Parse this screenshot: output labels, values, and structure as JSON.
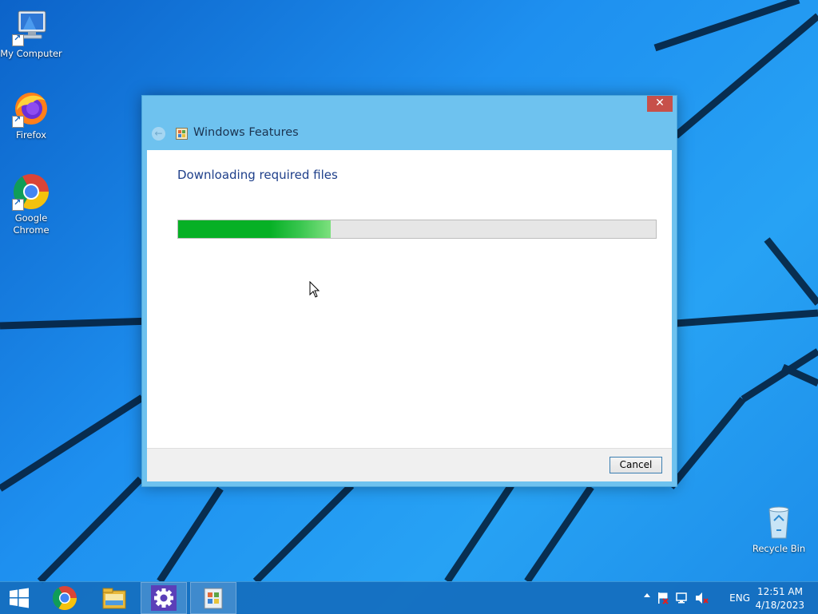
{
  "desktop": {
    "icons": [
      {
        "label": "My Computer",
        "icon": "computer-icon"
      },
      {
        "label": "Firefox",
        "icon": "firefox-icon"
      },
      {
        "label": "Google Chrome",
        "icon": "chrome-icon"
      },
      {
        "label": "Recycle Bin",
        "icon": "recycle-bin-icon"
      }
    ]
  },
  "dialog": {
    "title": "Windows Features",
    "close_glyph": "✕",
    "back_glyph": "←",
    "heading": "Downloading required files",
    "progress_fraction": 0.32,
    "cancel_label": "Cancel"
  },
  "taskbar": {
    "items": [
      {
        "icon": "start-windows-icon"
      },
      {
        "icon": "chrome-icon"
      },
      {
        "icon": "file-explorer-icon"
      },
      {
        "icon": "settings-gear-icon"
      },
      {
        "icon": "windows-features-icon"
      }
    ],
    "tray": {
      "language": "ENG",
      "time": "12:51 AM",
      "date": "4/18/2023",
      "icons": [
        "show-hidden-icons-chevron-icon",
        "action-center-flag-icon",
        "network-icon",
        "volume-muted-icon"
      ]
    }
  },
  "colors": {
    "progress_green": "#06b025",
    "dialog_frame": "#6ec2ef",
    "close_red": "#c7504a"
  }
}
